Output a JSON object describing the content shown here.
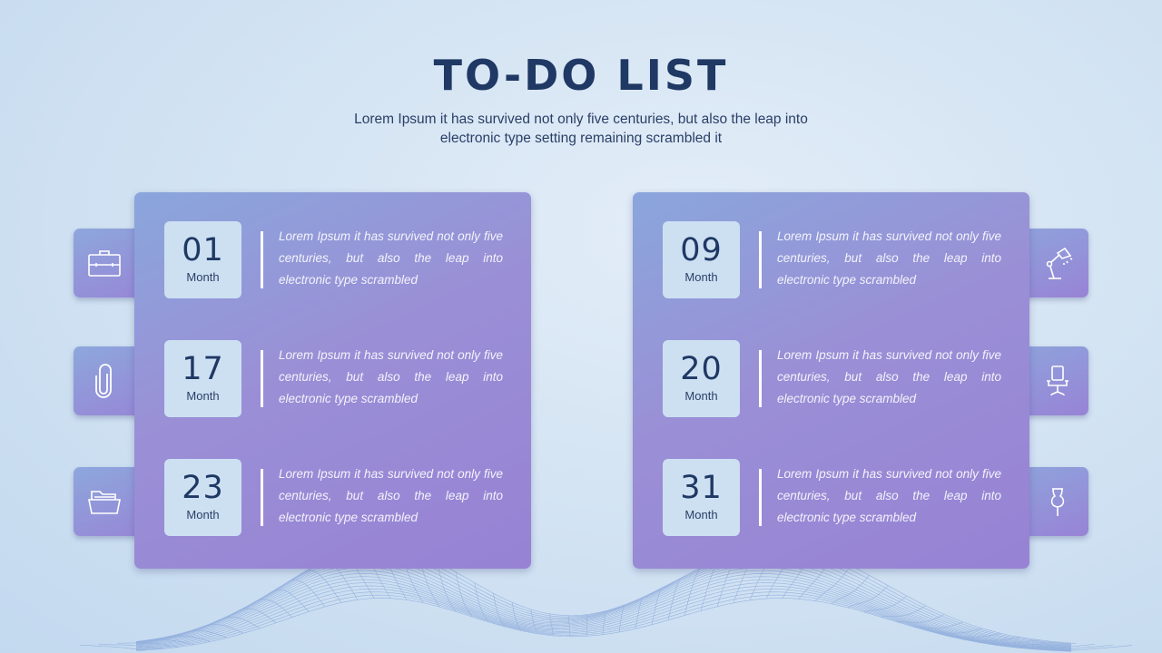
{
  "header": {
    "title": "TO-DO LIST",
    "subtitle": "Lorem Ipsum it has survived not only five centuries, but also the leap into electronic type setting remaining scrambled it"
  },
  "colors": {
    "title": "#1f3864",
    "panel_start": "#8aa6dc",
    "panel_end": "#9782d4",
    "date_box": "#cde0f2",
    "background": "#d4e4f3"
  },
  "left_panel": {
    "items": [
      {
        "number": "01",
        "label": "Month",
        "text": "Lorem Ipsum it has survived not only five centuries, but also the leap into electronic type scrambled",
        "icon": "briefcase-icon"
      },
      {
        "number": "17",
        "label": "Month",
        "text": "Lorem Ipsum it has survived not only five centuries, but also the leap into electronic type scrambled",
        "icon": "paperclip-icon"
      },
      {
        "number": "23",
        "label": "Month",
        "text": "Lorem Ipsum it has survived not only five centuries, but also the leap into electronic type scrambled",
        "icon": "folder-icon"
      }
    ]
  },
  "right_panel": {
    "items": [
      {
        "number": "09",
        "label": "Month",
        "text": "Lorem Ipsum it has survived not only five centuries, but also the leap into electronic type scrambled",
        "icon": "desk-lamp-icon"
      },
      {
        "number": "20",
        "label": "Month",
        "text": "Lorem Ipsum it has survived not only five centuries, but also the leap into electronic type scrambled",
        "icon": "office-chair-icon"
      },
      {
        "number": "31",
        "label": "Month",
        "text": "Lorem Ipsum it has survived not only five centuries, but also the leap into electronic type scrambled",
        "icon": "pushpin-icon"
      }
    ]
  }
}
